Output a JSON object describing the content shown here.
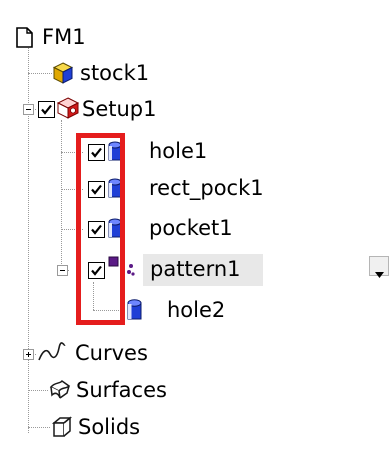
{
  "tree": {
    "root_label": "FM1",
    "stock_label": "stock1",
    "setup_label": "Setup1",
    "features": [
      {
        "label": "hole1"
      },
      {
        "label": "rect_pock1"
      },
      {
        "label": "pocket1"
      },
      {
        "label": "pattern1"
      }
    ],
    "pattern_child_label": "hole2",
    "curves_label": "Curves",
    "surfaces_label": "Surfaces",
    "solids_label": "Solids"
  },
  "icons": {
    "root": "file-icon",
    "stock": "stock-cube-icon",
    "setup": "setup-icon",
    "feature": "feature-cylinder-icon",
    "pattern": "pattern-icon",
    "curves": "curve-icon",
    "surfaces": "surface-icon",
    "solids": "solid-icon",
    "dropdown": "dropdown-arrow-icon"
  },
  "colors": {
    "highlight_box": "#e51d1d",
    "selection_background": "#e8e8e8",
    "feature_blue": "#1f3fd6",
    "stock_yellow": "#f2c200"
  }
}
